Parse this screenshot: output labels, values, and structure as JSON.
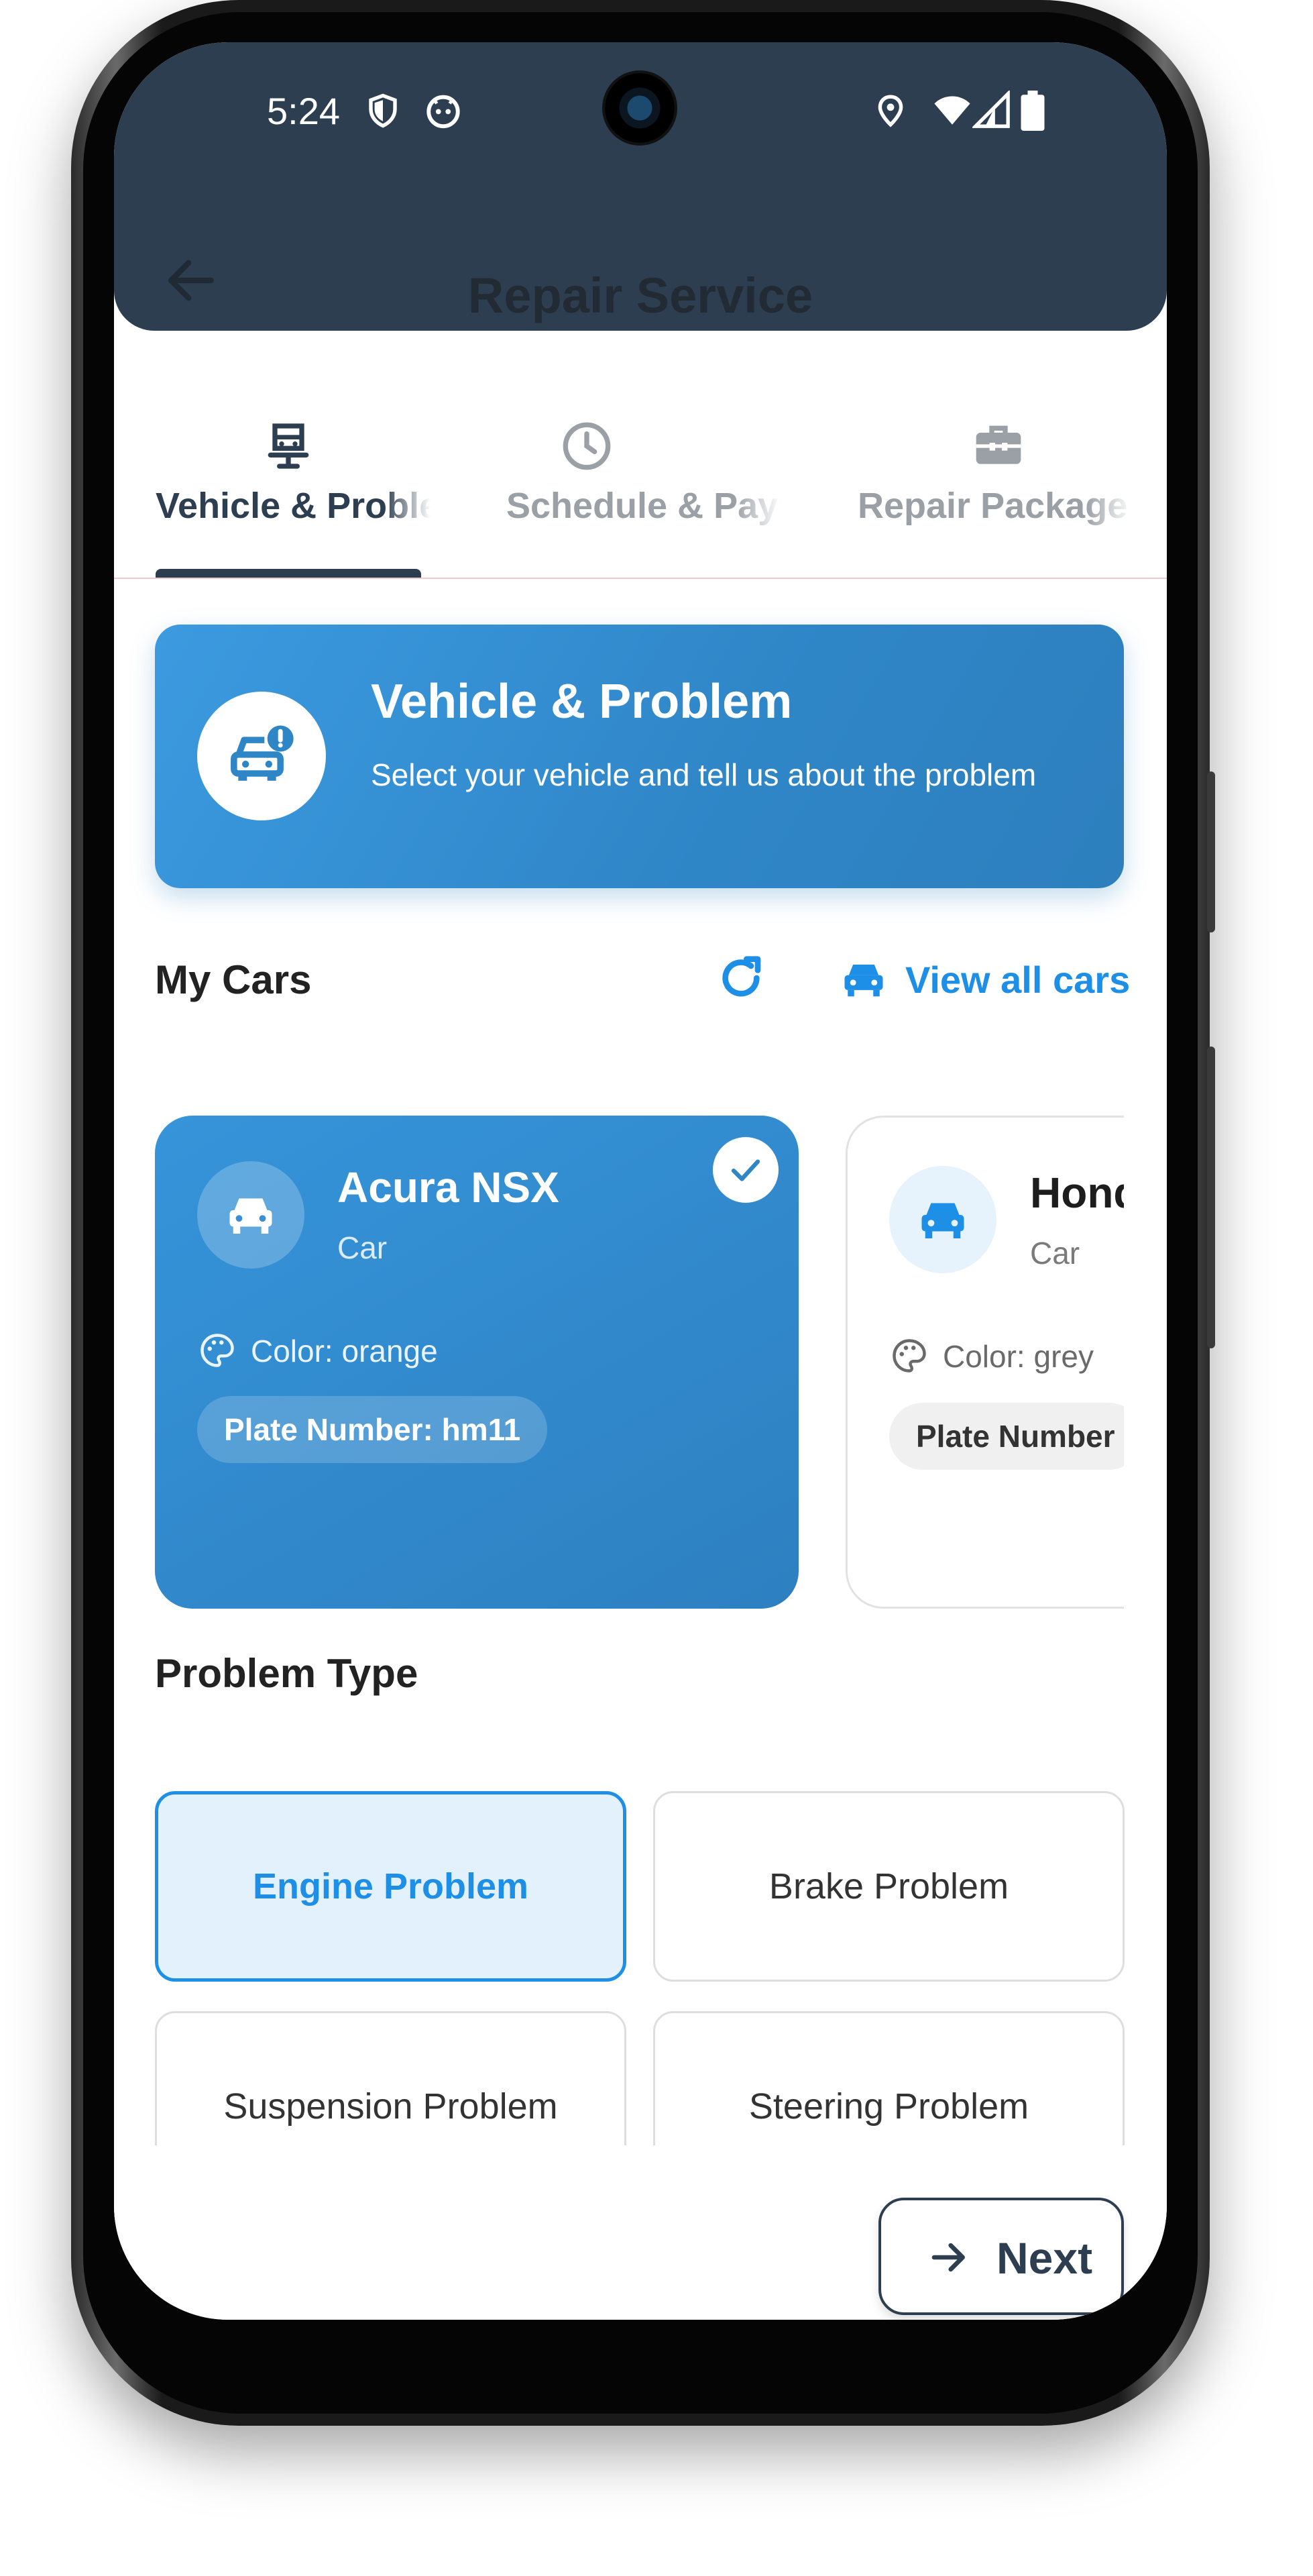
{
  "status_bar": {
    "time": "5:24",
    "left_icons": [
      "shield-icon",
      "android-face-icon"
    ],
    "right_icons": [
      "location-pin-icon",
      "wifi-icon",
      "signal-icon",
      "battery-icon"
    ]
  },
  "header": {
    "title": "Repair Service",
    "background_color": "#2d3e50"
  },
  "tabs": [
    {
      "label": "Vehicle & Problem",
      "icon": "car-seat-icon",
      "active": true
    },
    {
      "label": "Schedule & Payment",
      "icon": "clock-icon",
      "active": false
    },
    {
      "label": "Repair Package",
      "icon": "toolbox-icon",
      "active": false
    }
  ],
  "banner": {
    "title": "Vehicle & Problem",
    "subtitle": "Select your vehicle and tell us about the problem",
    "icon": "car-alert-icon"
  },
  "my_cars": {
    "title": "My Cars",
    "view_all_label": "View all cars",
    "cars": [
      {
        "name": "Acura NSX",
        "type": "Car",
        "color_text": "Color: orange",
        "plate_text": "Plate Number: hm11",
        "selected": true
      },
      {
        "name": "Honda",
        "type": "Car",
        "color_text": "Color: grey",
        "plate_text": "Plate Number",
        "selected": false
      }
    ]
  },
  "problem_type": {
    "title": "Problem Type",
    "options": [
      {
        "label": "Engine Problem",
        "selected": true
      },
      {
        "label": "Brake Problem",
        "selected": false
      },
      {
        "label": "Suspension Problem",
        "selected": false
      },
      {
        "label": "Steering Problem",
        "selected": false
      }
    ]
  },
  "footer": {
    "next_label": "Next"
  },
  "colors": {
    "accent_blue": "#1e8fe6",
    "card_blue": "#3694da",
    "dark_navy": "#2d3e50",
    "inactive_tab_text": "#9aa0a6"
  }
}
